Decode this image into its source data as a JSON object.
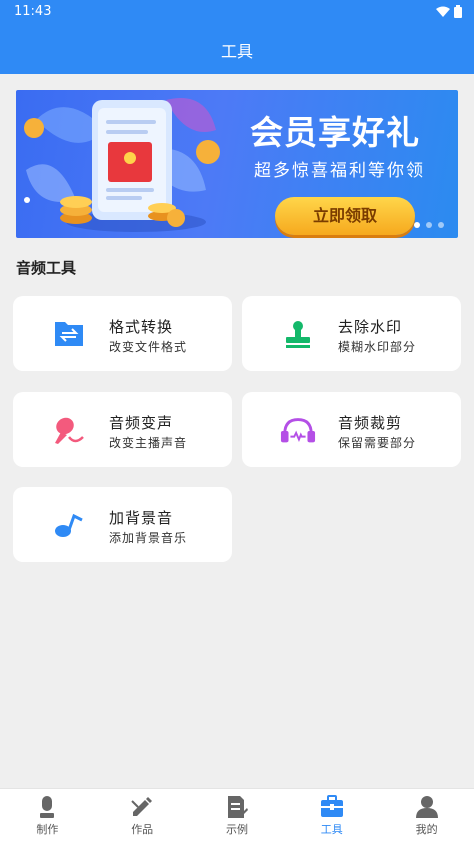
{
  "status": {
    "time": "11:43"
  },
  "appbar": {
    "title": "工具"
  },
  "banner": {
    "headline": "会员享好礼",
    "subline": "超多惊喜福利等你领",
    "cta": "立即领取"
  },
  "section": {
    "title": "音频工具"
  },
  "tools": [
    {
      "title": "格式转换",
      "desc": "改变文件格式",
      "icon": "format-convert-icon",
      "color": "#2f8af5"
    },
    {
      "title": "去除水印",
      "desc": "模糊水印部分",
      "icon": "stamp-icon",
      "color": "#14b86a"
    },
    {
      "title": "音频变声",
      "desc": "改变主播声音",
      "icon": "microphone-icon",
      "color": "#f35a7d"
    },
    {
      "title": "音频裁剪",
      "desc": "保留需要部分",
      "icon": "headphones-icon",
      "color": "#b44fe6"
    },
    {
      "title": "加背景音",
      "desc": "添加背景音乐",
      "icon": "music-note-icon",
      "color": "#2f8af5"
    }
  ],
  "tabs": [
    {
      "label": "制作",
      "icon": "microphone-icon"
    },
    {
      "label": "作品",
      "icon": "pencil-icon"
    },
    {
      "label": "示例",
      "icon": "document-icon"
    },
    {
      "label": "工具",
      "icon": "toolbox-icon",
      "active": true
    },
    {
      "label": "我的",
      "icon": "user-icon"
    }
  ],
  "colors": {
    "primary": "#2f8af5",
    "background": "#efefef"
  }
}
